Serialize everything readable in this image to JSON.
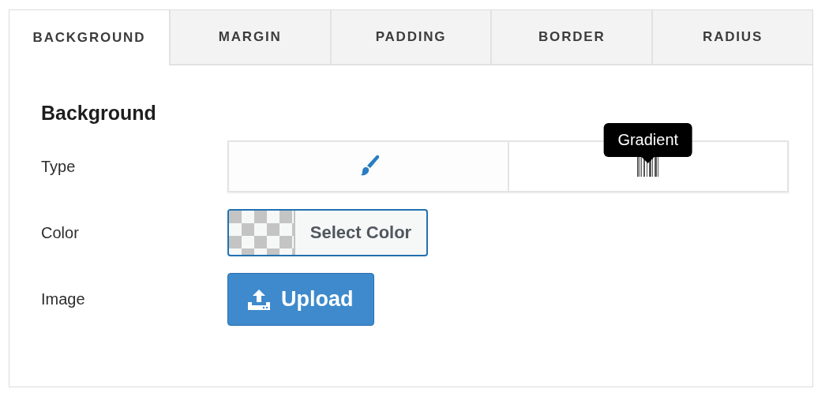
{
  "tabs": [
    {
      "label": "BACKGROUND",
      "selected": true
    },
    {
      "label": "MARGIN",
      "selected": false
    },
    {
      "label": "PADDING",
      "selected": false
    },
    {
      "label": "BORDER",
      "selected": false
    },
    {
      "label": "RADIUS",
      "selected": false
    }
  ],
  "section_title": "Background",
  "fields": [
    {
      "kind": "type",
      "label": "Type",
      "options": [
        {
          "kind": "solid",
          "selected": true
        },
        {
          "kind": "gradient",
          "selected": false,
          "tooltip": "Gradient"
        }
      ]
    },
    {
      "kind": "color",
      "label": "Color",
      "button": "Select Color"
    },
    {
      "kind": "image",
      "label": "Image",
      "button": "Upload"
    }
  ]
}
